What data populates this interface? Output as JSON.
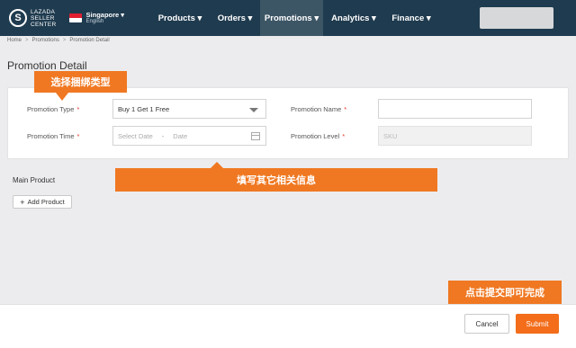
{
  "header": {
    "logo_letter": "S",
    "logo_lines": [
      "LAZADA",
      "SELLER",
      "CENTER"
    ],
    "country": "Singapore ▾",
    "language": "English",
    "nav": [
      {
        "label": "Products ▾"
      },
      {
        "label": "Orders ▾"
      },
      {
        "label": "Promotions ▾"
      },
      {
        "label": "Analytics ▾"
      },
      {
        "label": "Finance ▾"
      }
    ],
    "active_nav": "Promotions"
  },
  "breadcrumb": [
    "Home",
    "Promotions",
    "Promotion Detail"
  ],
  "breadcrumb_sep": ">",
  "page_title": "Promotion Detail",
  "form": {
    "promotion_type_label": "Promotion Type",
    "promotion_type_value": "Buy 1 Get 1 Free",
    "promotion_name_label": "Promotion Name",
    "promotion_name_value": "",
    "promotion_time_label": "Promotion Time",
    "start_date_placeholder": "Select Date",
    "date_separator": "-",
    "end_date_placeholder": "Date",
    "promotion_level_label": "Promotion Level",
    "promotion_level_value": "SKU",
    "required_mark": "*"
  },
  "main_product": {
    "title": "Main Product",
    "add_button_icon": "+",
    "add_button_label": "Add Product"
  },
  "callouts": {
    "select_type": "选择捆绑类型",
    "fill_info": "填写其它相关信息",
    "submit_hint": "点击提交即可完成"
  },
  "footer": {
    "cancel_label": "Cancel",
    "submit_label": "Submit"
  },
  "colors": {
    "header_bg": "#1f3b4f",
    "active_nav_bg": "#3d5666",
    "callout": "#f07822",
    "submit": "#f36d1a",
    "required": "#e63a2a"
  },
  "icons": [
    "lazada-logo-icon",
    "singapore-flag-icon",
    "dropdown-arrow-icon",
    "calendar-icon",
    "plus-icon"
  ]
}
